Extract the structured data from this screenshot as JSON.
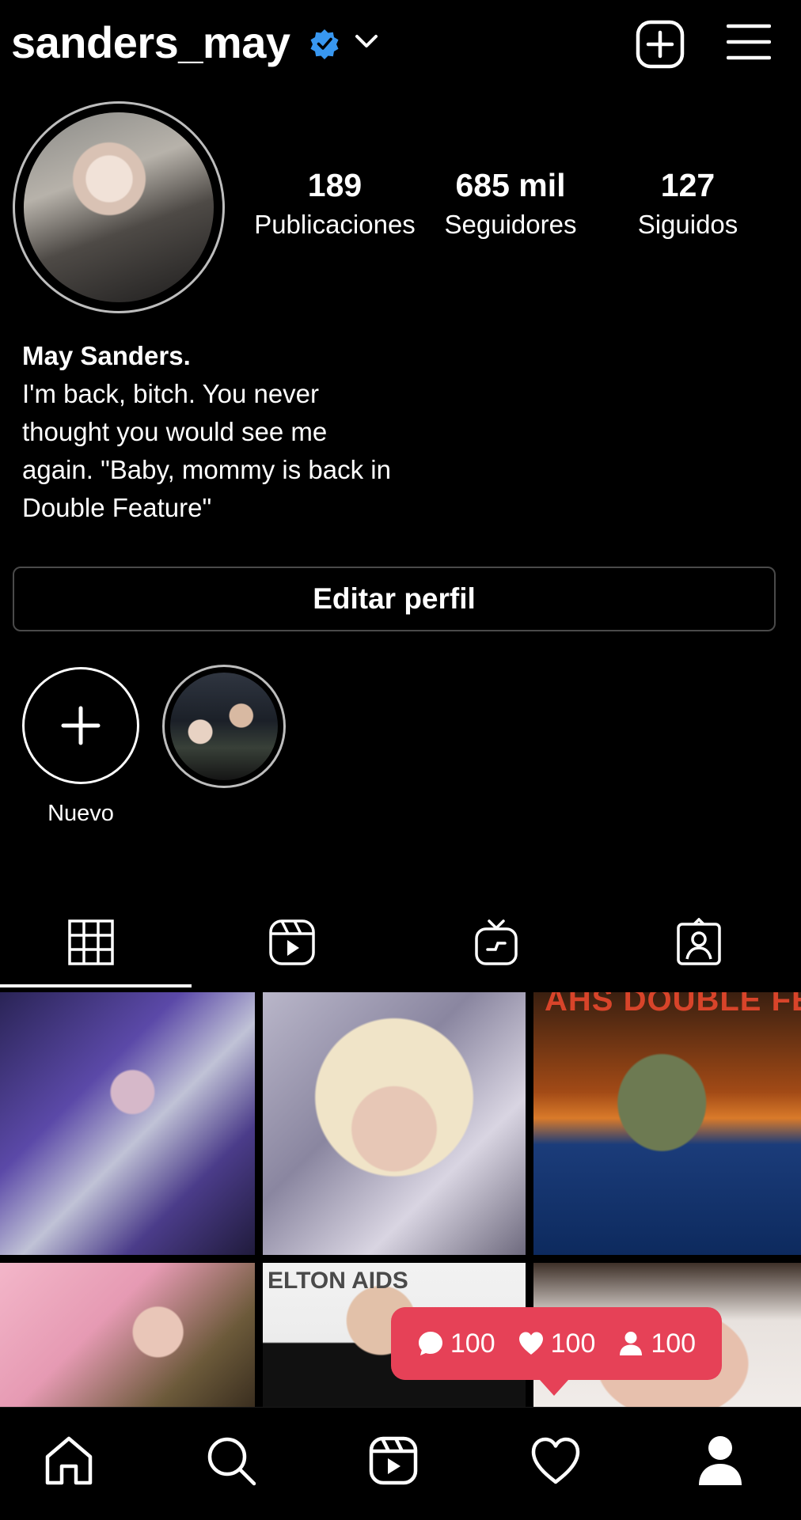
{
  "header": {
    "username": "sanders_may",
    "verified_icon": "verified-badge-icon",
    "accent_color": "#3897f0"
  },
  "profile": {
    "stats": [
      {
        "value": "189",
        "label": "Publicaciones"
      },
      {
        "value": "685 mil",
        "label": "Seguidores"
      },
      {
        "value": "127",
        "label": "Siguidos"
      }
    ],
    "name": "May Sanders.",
    "bio_lines": [
      "I'm back, bitch.  You never",
      "thought you would see me",
      "again.  \"Baby, mommy is back in",
      "Double Feature\""
    ],
    "edit_button": "Editar perfil"
  },
  "highlights": {
    "new_label": "Nuevo"
  },
  "grid": {
    "c3_text": "AHS DOUBLE FEATURE",
    "c5_text": "ELTON          AIDS"
  },
  "notification": {
    "comments": "100",
    "likes": "100",
    "followers": "100",
    "color": "#e64157"
  }
}
